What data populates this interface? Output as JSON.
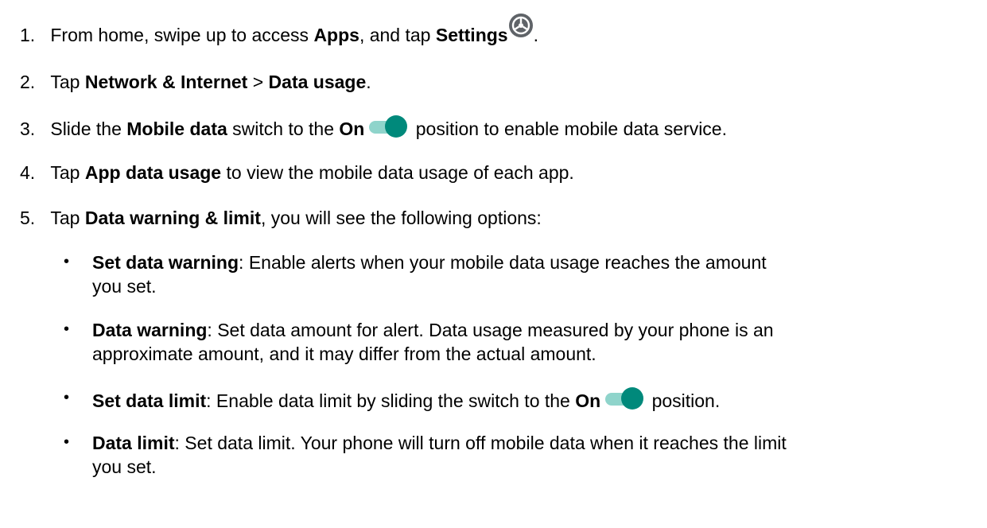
{
  "colors": {
    "toggle_track": "#8fd4cb",
    "toggle_knob": "#00897b",
    "gear_fill": "#5f6368"
  },
  "steps": [
    {
      "num": "1.",
      "t1": "From home, swipe up to access ",
      "b1": "Apps",
      "t2": ", and tap ",
      "b2": "Settings",
      "t3": "."
    },
    {
      "num": "2.",
      "t1": "Tap ",
      "b1": "Network & Internet",
      "t2": " > ",
      "b2": "Data usage",
      "t3": "."
    },
    {
      "num": "3.",
      "t1": "Slide the ",
      "b1": "Mobile data",
      "t2": " switch to the ",
      "b2": "On",
      "t3": " position to enable mobile data service."
    },
    {
      "num": "4.",
      "t1": "Tap ",
      "b1": "App data usage",
      "t2": " to view the mobile data usage of each app."
    },
    {
      "num": "5.",
      "t1": "Tap ",
      "b1": "Data warning & limit",
      "t2": ", you will see the following options:"
    }
  ],
  "bullets": [
    {
      "b1": "Set data warning",
      "t1": ": Enable alerts when your mobile data usage reaches the amount",
      "t2": "you set."
    },
    {
      "b1": "Data warning",
      "t1": ": Set data amount for alert. Data usage measured by your phone is an",
      "t2": "approximate amount, and it may differ from the actual amount."
    },
    {
      "b1": "Set data limit",
      "t1": ": Enable data limit by sliding the switch to the ",
      "b2": "On",
      "t2": " position."
    },
    {
      "b1": "Data limit",
      "t1": ": Set data limit. Your phone will turn off mobile data when it reaches the limit",
      "t2": "you set."
    }
  ],
  "bullet_char": "•",
  "icons": {
    "settings": "settings-gear-icon",
    "toggle": "toggle-on-icon"
  }
}
